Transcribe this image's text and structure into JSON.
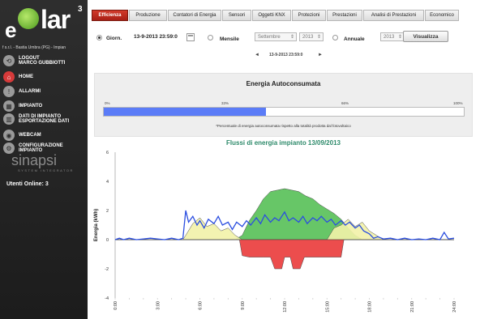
{
  "logo": {
    "prefix": "e",
    "wordmark": "lar",
    "superscript": "3"
  },
  "company": "f s.r.l. - Bastia Umbra (PG) - Impian",
  "menu": [
    {
      "label": "LOGOUT\nMARCO GUBBIOTTI",
      "icon": "logout-icon"
    },
    {
      "label": "HOME",
      "icon": "home-icon"
    },
    {
      "label": "ALLARMI",
      "icon": "alarm-icon"
    },
    {
      "label": "IMPIANTO",
      "icon": "plant-icon"
    },
    {
      "label": "DATI DI IMPIANTO\nESPORTAZIONE DATI",
      "icon": "data-export-icon"
    },
    {
      "label": "WEBCAM",
      "icon": "webcam-icon"
    },
    {
      "label": "CONFIGURAZIONE\nIMPIANTO",
      "icon": "settings-icon"
    }
  ],
  "sinapsi": {
    "name": "sinapsi",
    "tagline": "SYSTEM INTEGRATOR"
  },
  "utenti_online": "Utenti Online: 3",
  "tabs": [
    "Efficienza",
    "Produzione",
    "Contatori di Energia",
    "Sensori",
    "Oggetti KNX",
    "Protezioni",
    "Prestazioni",
    "Analisi di Prestazioni",
    "Economico"
  ],
  "active_tab": "Efficienza",
  "controls": {
    "giorn_label": "Giorn.",
    "date_value": "13-9-2013 23:59:0",
    "mensile_label": "Mensile",
    "month_value": "Settembre",
    "year_value": "2013",
    "annuale_label": "Annuale",
    "annual_year_value": "2013",
    "visualizza_label": "Visualizza",
    "nav_prev": "◄",
    "nav_next": "►",
    "nav_date": "13-9-2013 23:59:0"
  },
  "energy": {
    "title": "Energia Autoconsumata",
    "ticks": [
      "0%",
      "33%",
      "66%",
      "100%"
    ],
    "autoconsumo_fraction": 0.45,
    "footnote": "*Percentuale di energia autoconsumata rispetto alla totalità prodotta dal fotovoltaico",
    "bar_color": "#5b7cf7"
  },
  "chart_data": {
    "type": "area",
    "title": "Flussi di energia impianto 13/09/2013",
    "ylabel": "Energia (kWh)",
    "xlabel": "",
    "ylim": [
      -4,
      6
    ],
    "yticks": [
      "6",
      "4",
      "2",
      "0",
      "-2",
      "-4"
    ],
    "xlim": [
      0,
      24
    ],
    "xticks": [
      "0:00",
      "3:00",
      "6:00",
      "9:00",
      "12:00",
      "15:00",
      "18:00",
      "21:00",
      "24:00"
    ],
    "grid": false,
    "series": [
      {
        "color": "#57c057",
        "points": [
          [
            0,
            0
          ],
          [
            8.5,
            0
          ],
          [
            9,
            0.3
          ],
          [
            9.5,
            1.3
          ],
          [
            10,
            2.0
          ],
          [
            10.5,
            2.8
          ],
          [
            11,
            3.3
          ],
          [
            11.5,
            3.4
          ],
          [
            12,
            3.5
          ],
          [
            12.5,
            3.4
          ],
          [
            13,
            3.3
          ],
          [
            13.5,
            3.0
          ],
          [
            14,
            2.8
          ],
          [
            14.5,
            2.4
          ],
          [
            15,
            2.1
          ],
          [
            15.5,
            1.8
          ],
          [
            16,
            1.4
          ],
          [
            16.5,
            0.8
          ],
          [
            17,
            0.3
          ],
          [
            17.5,
            0
          ],
          [
            24,
            0
          ]
        ]
      },
      {
        "color": "#f2f2a8",
        "points": [
          [
            0,
            0
          ],
          [
            4.8,
            0
          ],
          [
            5,
            0.3
          ],
          [
            5.5,
            1.1
          ],
          [
            6,
            1.5
          ],
          [
            6.5,
            0.9
          ],
          [
            7,
            1.1
          ],
          [
            7.5,
            0.6
          ],
          [
            8,
            0.8
          ],
          [
            8.5,
            0.3
          ],
          [
            9,
            0
          ],
          [
            15,
            0
          ],
          [
            15.5,
            0.8
          ],
          [
            16,
            1.0
          ],
          [
            16.5,
            1.4
          ],
          [
            17,
            0.9
          ],
          [
            17.5,
            1.2
          ],
          [
            18,
            0.6
          ],
          [
            18.5,
            0.3
          ],
          [
            19,
            0
          ],
          [
            24,
            0
          ]
        ]
      },
      {
        "color": "#ea3a3a",
        "points": [
          [
            0,
            0
          ],
          [
            8.8,
            0
          ],
          [
            9,
            -1.1
          ],
          [
            9.5,
            -1.2
          ],
          [
            10.5,
            -1.2
          ],
          [
            11,
            -1.2
          ],
          [
            11.3,
            -2.0
          ],
          [
            11.8,
            -2.0
          ],
          [
            12,
            -1.2
          ],
          [
            12.4,
            -1.2
          ],
          [
            12.6,
            -2.0
          ],
          [
            13.1,
            -2.0
          ],
          [
            13.4,
            -1.2
          ],
          [
            14.5,
            -1.2
          ],
          [
            16,
            -1.2
          ],
          [
            16.2,
            0
          ],
          [
            24,
            0
          ]
        ]
      },
      {
        "color": "#2b4ee0",
        "points": [
          [
            0,
            0
          ],
          [
            0.3,
            0.1
          ],
          [
            0.6,
            0
          ],
          [
            1,
            0.1
          ],
          [
            1.5,
            0
          ],
          [
            2,
            0.05
          ],
          [
            2.5,
            0.1
          ],
          [
            3,
            0.05
          ],
          [
            3.5,
            0
          ],
          [
            4,
            0.1
          ],
          [
            4.5,
            0
          ],
          [
            4.8,
            0.1
          ],
          [
            5,
            2.0
          ],
          [
            5.2,
            1.2
          ],
          [
            5.5,
            1.6
          ],
          [
            5.8,
            1.0
          ],
          [
            6,
            1.3
          ],
          [
            6.3,
            0.8
          ],
          [
            6.6,
            1.4
          ],
          [
            7,
            1.1
          ],
          [
            7.3,
            1.6
          ],
          [
            7.6,
            1.0
          ],
          [
            8,
            1.2
          ],
          [
            8.3,
            0.7
          ],
          [
            8.6,
            1.2
          ],
          [
            9,
            0.9
          ],
          [
            9.3,
            1.3
          ],
          [
            9.6,
            1.0
          ],
          [
            10,
            1.5
          ],
          [
            10.3,
            1.1
          ],
          [
            10.6,
            1.7
          ],
          [
            11,
            1.2
          ],
          [
            11.3,
            1.5
          ],
          [
            11.6,
            1.3
          ],
          [
            12,
            1.9
          ],
          [
            12.3,
            1.3
          ],
          [
            12.6,
            1.5
          ],
          [
            13,
            1.2
          ],
          [
            13.3,
            1.6
          ],
          [
            13.6,
            1.1
          ],
          [
            14,
            1.5
          ],
          [
            14.3,
            1.3
          ],
          [
            14.6,
            1.6
          ],
          [
            15,
            1.2
          ],
          [
            15.3,
            1.4
          ],
          [
            15.6,
            1.0
          ],
          [
            16,
            1.3
          ],
          [
            16.3,
            1.0
          ],
          [
            16.6,
            1.2
          ],
          [
            17,
            0.8
          ],
          [
            17.3,
            1.0
          ],
          [
            17.6,
            0.6
          ],
          [
            18,
            0.4
          ],
          [
            18.3,
            0.1
          ],
          [
            18.6,
            0.2
          ],
          [
            19,
            0.05
          ],
          [
            19.5,
            0.1
          ],
          [
            20,
            0
          ],
          [
            20.5,
            0.1
          ],
          [
            21,
            0
          ],
          [
            21.5,
            0.05
          ],
          [
            22,
            0
          ],
          [
            22.5,
            0.1
          ],
          [
            23,
            0
          ],
          [
            23.3,
            0.5
          ],
          [
            23.6,
            0.05
          ],
          [
            24,
            0.1
          ]
        ]
      }
    ]
  }
}
